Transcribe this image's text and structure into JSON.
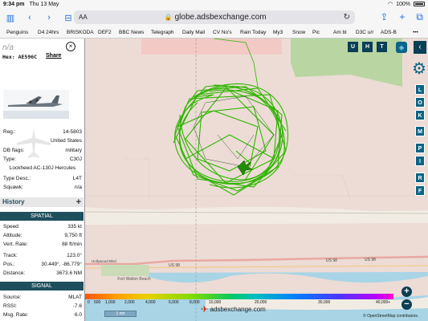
{
  "statusbar": {
    "time": "9:34 pm",
    "date": "Thu 13 May",
    "battery": "100%"
  },
  "toolbar": {
    "text_size": "AA",
    "url": "globe.adsbexchange.com"
  },
  "bookmarks": [
    "Penguins",
    "D4 24hrs",
    "BRISKODA",
    "DEF2",
    "BBC News",
    "Telegraph",
    "Daily Mail",
    "CV No's",
    "Rain Today",
    "My3",
    "Snow",
    "Pic",
    "Am bl",
    "D3C u/r",
    "ADS-B"
  ],
  "aircraft": {
    "callsign": "n/a",
    "hex_label": "Hex:",
    "hex": "AE596C",
    "share_label": "Share",
    "info": [
      {
        "label": "Reg.:",
        "value": "14-5803"
      },
      {
        "label": "",
        "value": "United States"
      },
      {
        "label": "DB flags:",
        "value": "military"
      },
      {
        "label": "Type:",
        "value": "C30J"
      },
      {
        "label": "",
        "value": "Lockheed AC-130J Hercules"
      },
      {
        "label": "Type Desc.:",
        "value": "L4T"
      },
      {
        "label": "Squawk:",
        "value": "n/a"
      }
    ]
  },
  "history": {
    "label": "History",
    "plus": "+"
  },
  "spatial": {
    "title": "SPATIAL",
    "rows": [
      {
        "label": "Speed:",
        "value": "335 kt"
      },
      {
        "label": "Altitude:",
        "value": "9,750 ft"
      },
      {
        "label": "Vert. Rate:",
        "value": "88 ft/min"
      },
      {
        "label": "Track:",
        "value": "123.0°"
      },
      {
        "label": "Pos.:",
        "value": "30.449°, -86.779°"
      },
      {
        "label": "Distance:",
        "value": "3673.6 NM"
      }
    ]
  },
  "signal": {
    "title": "SIGNAL",
    "rows": [
      {
        "label": "Source:",
        "value": "MLAT"
      },
      {
        "label": "RSSI:",
        "value": "-7.6"
      },
      {
        "label": "Msg. Rate:",
        "value": "6.0"
      }
    ]
  },
  "map": {
    "top_buttons": [
      "U",
      "H",
      "T"
    ],
    "side_buttons": [
      "L",
      "O",
      "K",
      "M",
      "P",
      "I",
      "R",
      "F"
    ],
    "label_fort_walton": "Fort Walton Beach",
    "label_us98_a": "US 98",
    "label_us98_b": "US 98",
    "label_us98_c": "US 98",
    "label_hwy": "Hollywood Blvd",
    "scale_label": "1 nm",
    "brand": "adsbexchange.com",
    "attribution": "© OpenStreetMap contributors."
  },
  "legend": {
    "ticks": [
      "0",
      "500",
      "1,000",
      "2,000",
      "4,000",
      "6,000",
      "8,000",
      "10,000",
      "20,000",
      "30,000",
      "40,000+"
    ]
  },
  "zoom": {
    "in": "+",
    "out": "−"
  },
  "colors": {
    "panel_section": "#1f4f5d",
    "map_button": "#0b6485",
    "track": "#2fb500",
    "water": "#a8d4e6",
    "land": "#ecdcd5"
  }
}
